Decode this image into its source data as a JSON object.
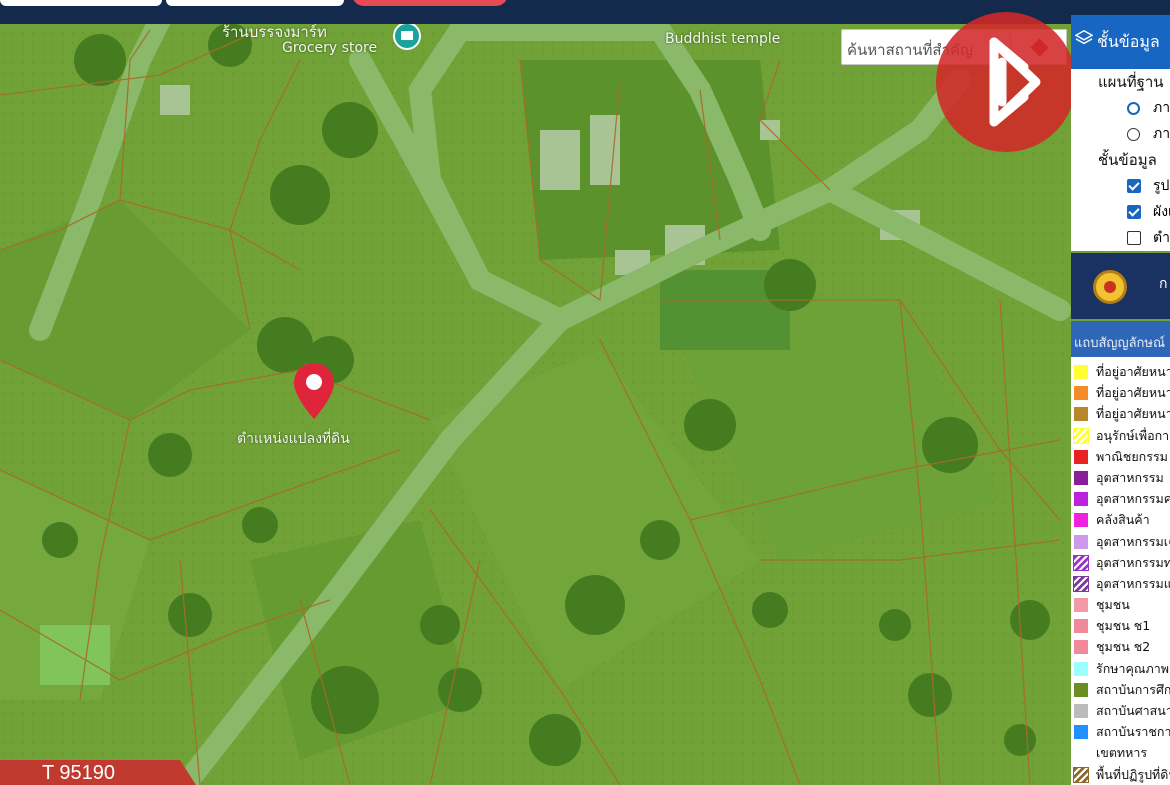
{
  "map": {
    "poi_grocery": "ร้านบรรจงมาร์ท",
    "poi_grocery_en": "Grocery store",
    "poi_temple_en": "Buddhist temple",
    "marker_label": "ตำแหน่งแปลงที่ดิน",
    "marker_icon": "map-pin-icon",
    "marker_color": "#e0243c"
  },
  "search": {
    "placeholder": "ค้นหาสถานที่สำคัญ",
    "button_icon": "diamond-icon"
  },
  "logo": {
    "icon": "brand-logo",
    "color": "#d22828"
  },
  "layer_panel": {
    "title": "ชั้นข้อมูล",
    "title_icon": "layers-icon",
    "basemap_title": "แผนที่ฐาน",
    "basemap_options": [
      {
        "label": "ภาพ",
        "selected": true
      },
      {
        "label": "ภาพ",
        "selected": false
      }
    ],
    "data_layers_title": "ชั้นข้อมูล",
    "data_layers": [
      {
        "label": "รูปแปลง",
        "checked": true
      },
      {
        "label": "ผังเมือง",
        "checked": true
      },
      {
        "label": "ตำแหน่ง",
        "checked": false
      }
    ],
    "accent": "#1766c2"
  },
  "dept_bar": {
    "letter": "ก",
    "seal_icon": "department-seal-icon"
  },
  "legend": {
    "title": "แถบสัญญลักษณ์",
    "items": [
      {
        "label": "ที่อยู่อาศัยหนาแน่นน้อย",
        "color": "#ffff33",
        "pattern": "solid"
      },
      {
        "label": "ที่อยู่อาศัยหนาแน่นปานกลาง",
        "color": "#f28c28",
        "pattern": "solid"
      },
      {
        "label": "ที่อยู่อาศัยหนาแน่นมาก",
        "color": "#b8862b",
        "pattern": "solid"
      },
      {
        "label": "อนุรักษ์เพื่อการอยู่อาศัย",
        "color": "#ffff33",
        "pattern": "hatch"
      },
      {
        "label": "พาณิชยกรรม",
        "color": "#e8231f",
        "pattern": "solid"
      },
      {
        "label": "อุตสาหกรรม",
        "color": "#8a1f9a",
        "pattern": "solid"
      },
      {
        "label": "อุตสาหกรรมคลังสินค้า",
        "color": "#bb22dd",
        "pattern": "solid"
      },
      {
        "label": "คลังสินค้า",
        "color": "#ee22dd",
        "pattern": "solid"
      },
      {
        "label": "อุตสาหกรรมเฉพาะกิจ",
        "color": "#cc99ee",
        "pattern": "solid"
      },
      {
        "label": "อุตสาหกรรมท่าเรือ",
        "color": "#9933cc",
        "pattern": "hatch"
      },
      {
        "label": "อุตสาหกรรมและคลังสินค้า",
        "color": "#7a3aa0",
        "pattern": "hatch"
      },
      {
        "label": "ชุมชน",
        "color": "#f29aa7",
        "pattern": "solid"
      },
      {
        "label": "ชุมชน ช1",
        "color": "#f08a9a",
        "pattern": "solid"
      },
      {
        "label": "ชุมชน ช2",
        "color": "#f08a9a",
        "pattern": "solid"
      },
      {
        "label": "รักษาคุณภาพสิ่งแวดล้อม",
        "color": "#99ffff",
        "pattern": "solid"
      },
      {
        "label": "สถาบันการศึกษา",
        "color": "#6b8e23",
        "pattern": "solid"
      },
      {
        "label": "สถาบันศาสนา",
        "color": "#bbbbbb",
        "pattern": "solid"
      },
      {
        "label": "สถาบันราชการ",
        "color": "#1e90ff",
        "pattern": "solid"
      },
      {
        "label": "เขตทหาร",
        "color": "",
        "pattern": "none"
      },
      {
        "label": "พื้นที่ปฏิรูปที่ดิน",
        "color": "#8b6b2b",
        "pattern": "hatch"
      }
    ]
  },
  "tag": {
    "text": "T 95190",
    "color": "#c03a30"
  }
}
